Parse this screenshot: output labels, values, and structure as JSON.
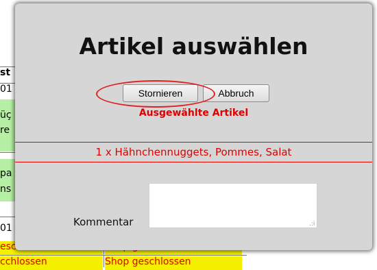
{
  "background": {
    "fragments": [
      "st",
      "01",
      "üç",
      "re",
      "pa",
      "ns",
      "01"
    ],
    "rows": [
      {
        "col1": "eschlossen",
        "col2": "Shop geschlossen"
      },
      {
        "col1": "cchlossen",
        "col2": "Shop geschlossen"
      }
    ]
  },
  "dialog": {
    "title": "Artikel auswählen",
    "cancel_order_label": "Stornieren",
    "abort_label": "Abbruch",
    "selected_heading": "Ausgewählte Artikel",
    "items": [
      "1 x Hähnchennuggets, Pommes, Salat"
    ],
    "comment_label": "Kommentar",
    "comment_value": ""
  },
  "colors": {
    "accent_red": "#e00000",
    "dialog_bg": "#d6d6d6",
    "highlight_green": "#b7f0a4",
    "highlight_yellow": "#f5f000"
  }
}
